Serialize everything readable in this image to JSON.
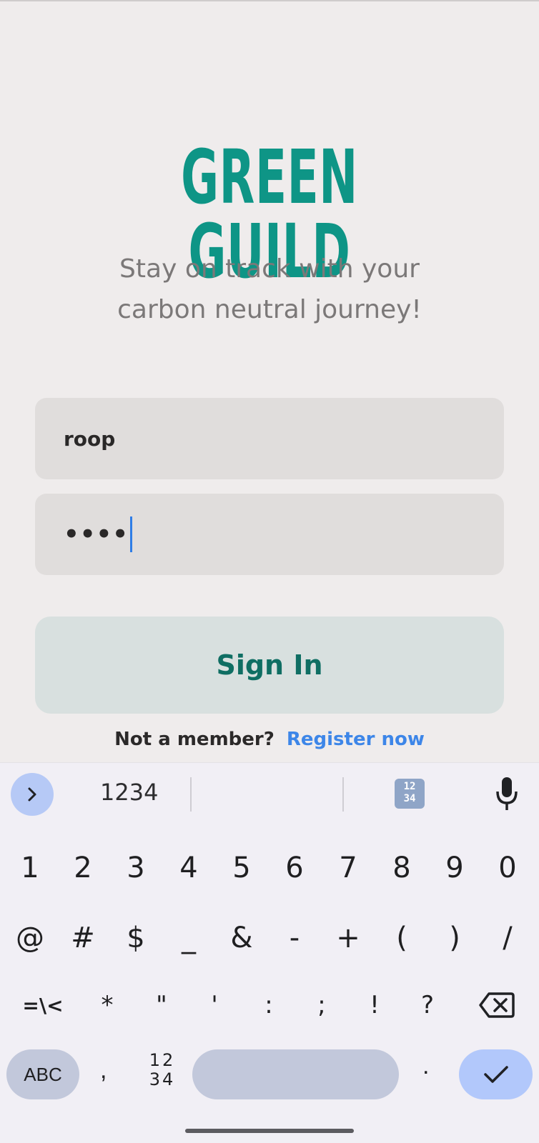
{
  "app": {
    "title": "GREEN GUILD",
    "tagline_line1": "Stay on track with your",
    "tagline_line2": "carbon neutral journey!"
  },
  "login": {
    "username_value": "roop",
    "password_value": "••••",
    "sign_in_label": "Sign In",
    "register_prompt": "Not a member?",
    "register_link": "Register now"
  },
  "keyboard": {
    "suggestions": [
      "1234",
      ""
    ],
    "row1": [
      "1",
      "2",
      "3",
      "4",
      "5",
      "6",
      "7",
      "8",
      "9",
      "0"
    ],
    "row2": [
      "@",
      "#",
      "$",
      "_",
      "&",
      "-",
      "+",
      "(",
      ")",
      "/"
    ],
    "row3": [
      "=\\<",
      "*",
      "\"",
      "'",
      ":",
      ";",
      "!",
      "?"
    ],
    "abc_label": "ABC",
    "comma": ",",
    "num_toggle_top": "12",
    "num_toggle_bottom": "34",
    "period": ".",
    "icons": [
      "chevron-right-icon",
      "numpad-icon",
      "mic-icon",
      "backspace-icon",
      "checkmark-icon"
    ]
  },
  "colors": {
    "brand": "#0e9586",
    "link": "#3d86e8",
    "button_text": "#0f6e63"
  }
}
